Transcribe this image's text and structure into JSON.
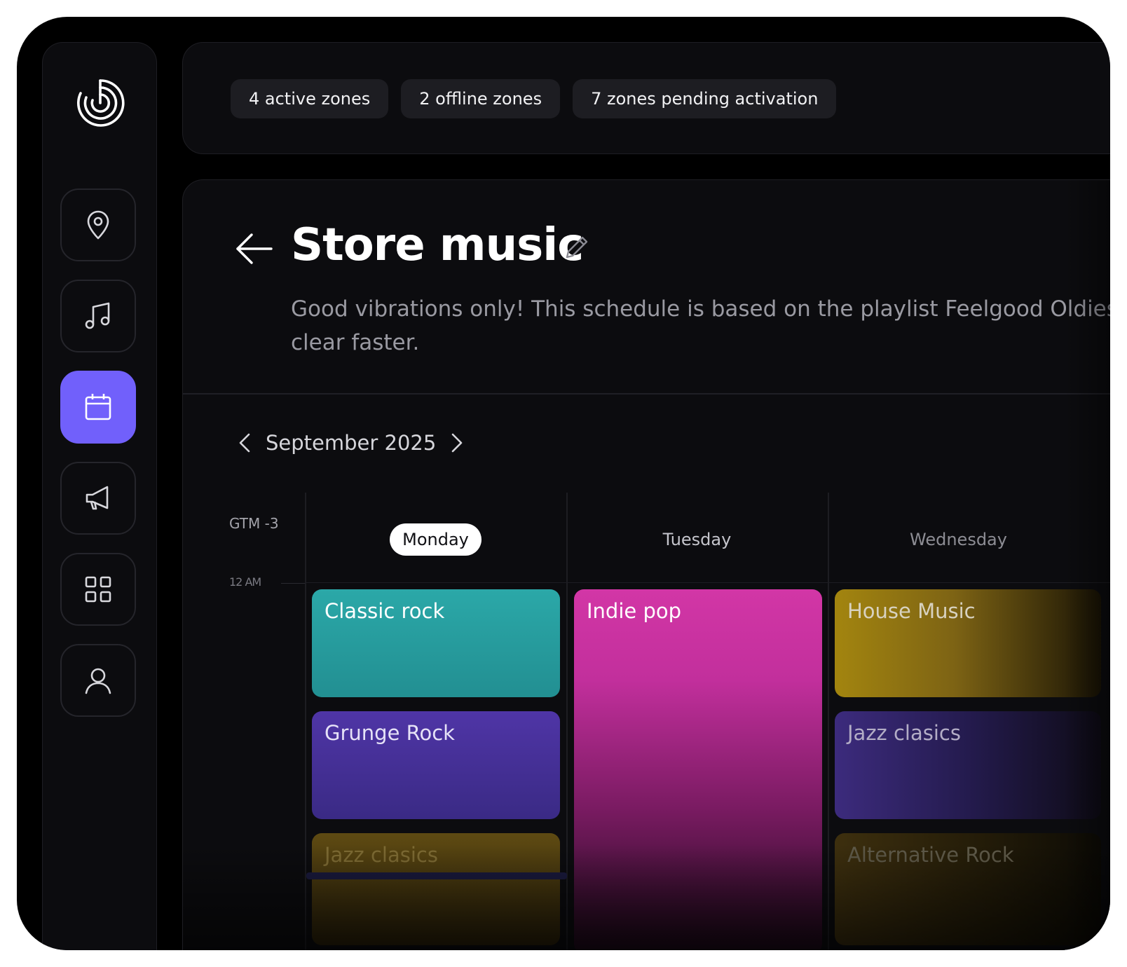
{
  "status_pills": [
    {
      "label": "4 active zones"
    },
    {
      "label": "2 offline zones"
    },
    {
      "label": "7 zones pending activation"
    }
  ],
  "sidebar": {
    "items": [
      {
        "icon": "location-pin-icon"
      },
      {
        "icon": "music-note-icon"
      },
      {
        "icon": "calendar-icon",
        "active": true
      },
      {
        "icon": "megaphone-icon"
      },
      {
        "icon": "grid-icon"
      },
      {
        "icon": "user-icon"
      }
    ],
    "accent_color": "#7160fb"
  },
  "page": {
    "title": "Store music",
    "description": "Good vibrations only! This schedule is based on the playlist Feelgood Oldies clear faster."
  },
  "calendar": {
    "month": "September 2025",
    "timezone": "GTM -3",
    "time_mark": "12 AM",
    "days": [
      {
        "label": "Monday",
        "selected": true
      },
      {
        "label": "Tuesday"
      },
      {
        "label": "Wednesday"
      }
    ],
    "events": {
      "monday": [
        {
          "label": "Classic rock",
          "color": "#2ba8a8"
        },
        {
          "label": "Grunge Rock",
          "color": "#4f35a6"
        },
        {
          "label": "Jazz clasics",
          "color": "#5e4a12"
        }
      ],
      "tuesday": [
        {
          "label": "Indie pop",
          "color": "#d236a6"
        }
      ],
      "wednesday": [
        {
          "label": "House Music",
          "color": "#a3850f"
        },
        {
          "label": "Jazz clasics",
          "color": "#3c2b7d"
        },
        {
          "label": "Alternative Rock",
          "color": "#3d2f0e"
        }
      ]
    }
  }
}
